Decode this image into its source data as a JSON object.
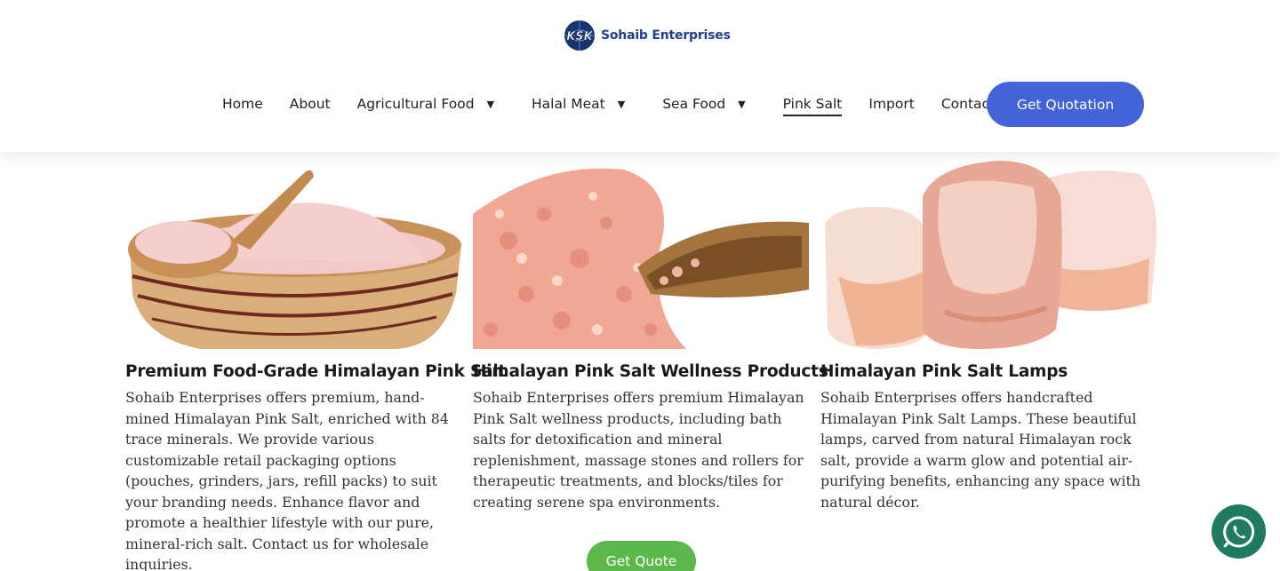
{
  "brand": {
    "name": "Sohaib Enterprises",
    "logo_text": "KSK"
  },
  "nav": {
    "items": [
      {
        "label": "Home",
        "dropdown": false,
        "active": false
      },
      {
        "label": "About",
        "dropdown": false,
        "active": false
      },
      {
        "label": "Agricultural Food",
        "dropdown": true,
        "active": false
      },
      {
        "label": "Halal Meat",
        "dropdown": true,
        "active": false
      },
      {
        "label": "Sea Food",
        "dropdown": true,
        "active": false
      },
      {
        "label": "Pink Salt",
        "dropdown": false,
        "active": true
      },
      {
        "label": "Import",
        "dropdown": false,
        "active": false
      },
      {
        "label": "Contact",
        "dropdown": false,
        "active": false
      }
    ],
    "cta_label": "Get Quotation"
  },
  "products": [
    {
      "title": "Premium Food-Grade Himalayan Pink Salt",
      "description": "Sohaib Enterprises offers premium, hand-mined Himalayan Pink Salt, enriched with 84 trace minerals. We provide various customizable retail packaging options (pouches, grinders, jars, refill packs) to suit your branding needs. Enhance flavor and promote a healthier lifestyle with our pure, mineral-rich salt. Contact us for wholesale inquiries.",
      "image": "pink-salt-bowl-image"
    },
    {
      "title": "Himalayan Pink Salt Wellness Products",
      "description": "Sohaib Enterprises offers premium Himalayan Pink Salt wellness products, including bath salts for detoxification and mineral replenishment, massage stones and rollers for therapeutic treatments, and blocks/tiles for creating serene spa environments.",
      "image": "pink-salt-crystals-scoop-image"
    },
    {
      "title": "Himalayan Pink Salt Lamps",
      "description": "Sohaib Enterprises offers handcrafted Himalayan Pink Salt Lamps. These beautiful lamps, carved from natural Himalayan rock salt, provide a warm glow and potential air-purifying benefits, enhancing any space with natural décor.",
      "image": "salt-lamps-image"
    }
  ],
  "get_quote_label": "Get Quote",
  "colors": {
    "brand_blue": "#1f3f93",
    "cta_blue": "#4463d8",
    "green_button": "#5cb84c",
    "whatsapp_green": "#1e7a61"
  },
  "icons": {
    "floating": "whatsapp-icon",
    "caret": "caret-down-icon"
  }
}
